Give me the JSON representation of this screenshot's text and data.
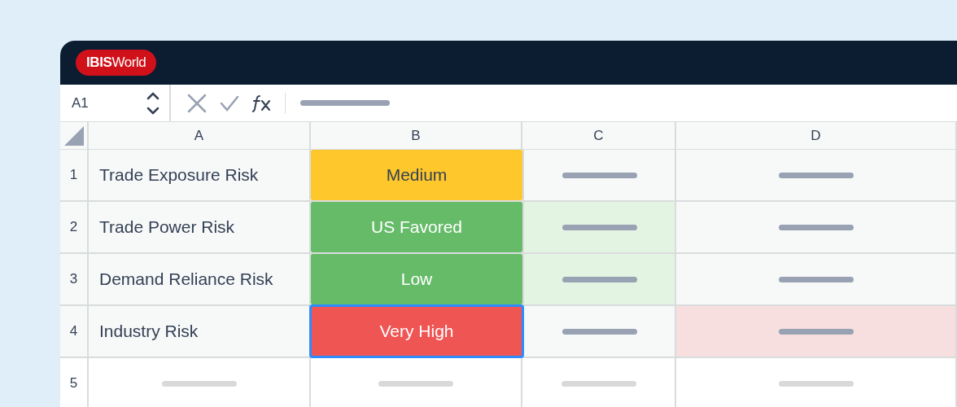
{
  "logo": "**IBIS**World",
  "formula_bar": {
    "name_box": "A1"
  },
  "columns": [
    "A",
    "B",
    "C",
    "D"
  ],
  "rows": [
    {
      "number": "1",
      "empty": false,
      "label": "Trade Exposure Risk",
      "rating": {
        "text": "Medium",
        "color": "#fec72b",
        "selected": false
      }
    },
    {
      "number": "2",
      "empty": false,
      "label": "Trade Power Risk",
      "rating": {
        "text": "US Favored",
        "color": "#66bb69",
        "selected": false
      },
      "c_cell": {
        "color": "#e3f4e2"
      }
    },
    {
      "number": "3",
      "empty": false,
      "label": "Demand Reliance Risk",
      "rating": {
        "text": "Low",
        "color": "#66bb69",
        "selected": false
      },
      "c_cell": {
        "color": "#e3f4e2"
      }
    },
    {
      "number": "4",
      "empty": false,
      "label": "Industry Risk",
      "rating": {
        "text": "Very High",
        "color": "#ef5553",
        "selected": true
      },
      "d_cell": {
        "color": "#f8dfdf"
      }
    },
    {
      "number": "5",
      "empty": true
    }
  ]
}
